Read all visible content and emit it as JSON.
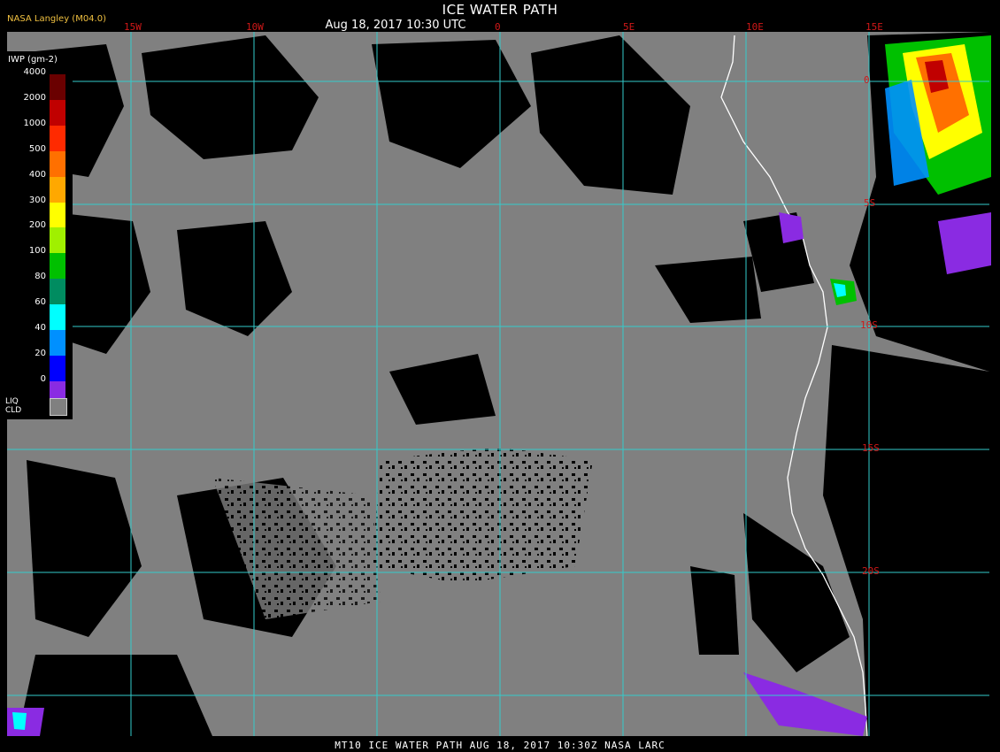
{
  "header": {
    "title": "ICE WATER PATH",
    "datetime": "Aug 18, 2017 10:30 UTC",
    "credit": "NASA Langley (M04.0)"
  },
  "footer": {
    "text": "MT10  ICE WATER PATH  AUG 18, 2017 10:30Z  NASA LARC"
  },
  "longitude_labels": [
    "15W",
    "10W",
    "0",
    "5E",
    "10E",
    "15E"
  ],
  "latitude_labels": [
    "0",
    "5S",
    "10S",
    "15S",
    "20S"
  ],
  "legend": {
    "title": "IWP (gm-2)",
    "levels": [
      {
        "label": "4000",
        "color": "#6a0000"
      },
      {
        "label": "2000",
        "color": "#c00000"
      },
      {
        "label": "1000",
        "color": "#ff2a00"
      },
      {
        "label": "500",
        "color": "#ff7000"
      },
      {
        "label": "400",
        "color": "#ffa800"
      },
      {
        "label": "300",
        "color": "#ffff00"
      },
      {
        "label": "200",
        "color": "#a0f000"
      },
      {
        "label": "100",
        "color": "#00c000"
      },
      {
        "label": "80",
        "color": "#008c60"
      },
      {
        "label": "60",
        "color": "#00ffff"
      },
      {
        "label": "40",
        "color": "#0090ff"
      },
      {
        "label": "20",
        "color": "#0000ff"
      },
      {
        "label": "0",
        "color": "#8a2be2"
      }
    ],
    "liq_label_1": "LIQ",
    "liq_label_2": "CLD",
    "liq_color": "#808080"
  },
  "colors": {
    "grid": "#33cccc",
    "coast": "#ffffff",
    "cloud": "#808080",
    "axis_label": "#d01818"
  }
}
